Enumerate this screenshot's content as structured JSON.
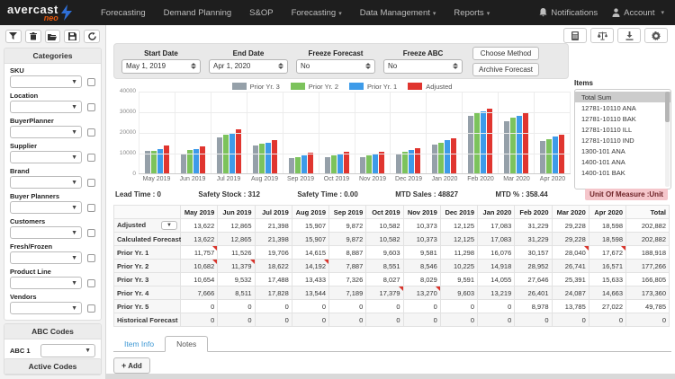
{
  "nav": {
    "brand": {
      "name": "avercast",
      "sub": "neo"
    },
    "items": [
      {
        "label": "Forecasting",
        "dropdown": false
      },
      {
        "label": "Demand Planning",
        "dropdown": false
      },
      {
        "label": "S&OP",
        "dropdown": false
      },
      {
        "label": "Forecasting",
        "dropdown": true
      },
      {
        "label": "Data Management",
        "dropdown": true
      },
      {
        "label": "Reports",
        "dropdown": true
      }
    ],
    "notifications_label": "Notifications",
    "account_label": "Account"
  },
  "sidebar": {
    "toolbar_icons": [
      "filter-icon",
      "trash-icon",
      "folder-open-icon",
      "save-icon",
      "refresh-icon"
    ],
    "categories_title": "Categories",
    "categories": [
      "SKU",
      "Location",
      "BuyerPlanner",
      "Supplier",
      "Brand",
      "Buyer Planners",
      "Customers",
      "Fresh/Frozen",
      "Product Line",
      "Vendors"
    ],
    "abc_title": "ABC Codes",
    "abc_label": "ABC 1",
    "active_codes_title": "Active Codes"
  },
  "filters": {
    "start_date": {
      "label": "Start Date",
      "value": "May 1, 2019"
    },
    "end_date": {
      "label": "End Date",
      "value": "Apr 1, 2020"
    },
    "freeze_forecast": {
      "label": "Freeze Forecast",
      "value": "No"
    },
    "freeze_abc": {
      "label": "Freeze ABC",
      "value": "No"
    },
    "choose_method_label": "Choose Method",
    "archive_forecast_label": "Archive Forecast"
  },
  "chart_data": {
    "type": "bar",
    "categories": [
      "May 2019",
      "Jun 2019",
      "Jul 2019",
      "Aug 2019",
      "Sep 2019",
      "Oct 2019",
      "Nov 2019",
      "Dec 2019",
      "Jan 2020",
      "Feb 2020",
      "Mar 2020",
      "Apr 2020"
    ],
    "series": [
      {
        "name": "Prior Yr. 3",
        "color": "#95a0a9",
        "values": [
          10654,
          9532,
          17488,
          13433,
          7326,
          8027,
          8029,
          9591,
          14055,
          27646,
          25391,
          15633
        ]
      },
      {
        "name": "Prior Yr. 2",
        "color": "#7cc35c",
        "values": [
          10682,
          11379,
          18622,
          14192,
          7887,
          8551,
          8546,
          10225,
          14918,
          28952,
          26741,
          16571
        ]
      },
      {
        "name": "Prior Yr. 1",
        "color": "#3d9be9",
        "values": [
          11757,
          11526,
          19706,
          14615,
          8887,
          9603,
          9581,
          11298,
          16076,
          30157,
          28040,
          17672
        ]
      },
      {
        "name": "Adjusted",
        "color": "#e0352f",
        "values": [
          13622,
          12865,
          21398,
          15907,
          9872,
          10582,
          10373,
          12125,
          17083,
          31229,
          29228,
          18598
        ]
      }
    ],
    "ylim": [
      0,
      40000
    ],
    "yticks": [
      0,
      10000,
      20000,
      30000,
      40000
    ],
    "legend_position": "top",
    "grid": true,
    "title": "",
    "xlabel": "",
    "ylabel": ""
  },
  "items_panel": {
    "title": "Items",
    "selected": "Total Sum",
    "list": [
      "Total Sum",
      "12781-10110 ANA",
      "12781-10110 BAK",
      "12781-10110 ILL",
      "12781-10110 IND",
      "1300-101 ANA",
      "1400-101 ANA",
      "1400-101 BAK"
    ]
  },
  "stats": [
    {
      "text": "Lead Time : 0",
      "highlight": false
    },
    {
      "text": "Safety Stock : 312",
      "highlight": false
    },
    {
      "text": "Safety Time : 0.00",
      "highlight": false
    },
    {
      "text": "MTD Sales : 48827",
      "highlight": false
    },
    {
      "text": "MTD % : 358.44",
      "highlight": false
    },
    {
      "text": "Unit Of Measure :Unit",
      "highlight": true
    }
  ],
  "table": {
    "columns": [
      "",
      "May 2019",
      "Jun 2019",
      "Jul 2019",
      "Aug 2019",
      "Sep 2019",
      "Oct 2019",
      "Nov 2019",
      "Dec 2019",
      "Jan 2020",
      "Feb 2020",
      "Mar 2020",
      "Apr 2020",
      "Total"
    ],
    "rows": [
      {
        "label": "Adjusted",
        "has_dropdown": true,
        "flags": [],
        "values": [
          "13,622",
          "12,865",
          "21,398",
          "15,907",
          "9,872",
          "10,582",
          "10,373",
          "12,125",
          "17,083",
          "31,229",
          "29,228",
          "18,598",
          "202,882"
        ]
      },
      {
        "label": "Calculated Forecast",
        "has_dropdown": false,
        "flags": [],
        "values": [
          "13,622",
          "12,865",
          "21,398",
          "15,907",
          "9,872",
          "10,582",
          "10,373",
          "12,125",
          "17,083",
          "31,229",
          "29,228",
          "18,598",
          "202,882"
        ]
      },
      {
        "label": "Prior Yr. 1",
        "has_dropdown": false,
        "flags": [
          0,
          10,
          11
        ],
        "values": [
          "11,757",
          "11,526",
          "19,706",
          "14,615",
          "8,887",
          "9,603",
          "9,581",
          "11,298",
          "16,076",
          "30,157",
          "28,040",
          "17,672",
          "188,918"
        ]
      },
      {
        "label": "Prior Yr. 2",
        "has_dropdown": false,
        "flags": [
          0,
          1,
          3
        ],
        "values": [
          "10,682",
          "11,379",
          "18,622",
          "14,192",
          "7,887",
          "8,551",
          "8,546",
          "10,225",
          "14,918",
          "28,952",
          "26,741",
          "16,571",
          "177,266"
        ]
      },
      {
        "label": "Prior Yr. 3",
        "has_dropdown": false,
        "flags": [],
        "values": [
          "10,654",
          "9,532",
          "17,488",
          "13,433",
          "7,326",
          "8,027",
          "8,029",
          "9,591",
          "14,055",
          "27,646",
          "25,391",
          "15,633",
          "166,805"
        ]
      },
      {
        "label": "Prior Yr. 4",
        "has_dropdown": false,
        "flags": [
          5,
          6
        ],
        "values": [
          "7,666",
          "8,511",
          "17,828",
          "13,544",
          "7,189",
          "17,379",
          "13,270",
          "9,603",
          "13,219",
          "26,401",
          "24,087",
          "14,663",
          "173,360"
        ]
      },
      {
        "label": "Prior Yr. 5",
        "has_dropdown": false,
        "flags": [],
        "values": [
          "0",
          "0",
          "0",
          "0",
          "0",
          "0",
          "0",
          "0",
          "0",
          "8,978",
          "13,785",
          "27,022",
          "49,785"
        ]
      },
      {
        "label": "Historical Forecast",
        "has_dropdown": false,
        "flags": [],
        "values": [
          "0",
          "0",
          "0",
          "0",
          "0",
          "0",
          "0",
          "0",
          "0",
          "0",
          "0",
          "0",
          "0"
        ]
      }
    ]
  },
  "tabs": {
    "item_info_label": "Item Info",
    "notes_label": "Notes",
    "add_label": "Add"
  },
  "colors": {
    "nav_bg": "#1e1e1e",
    "brand_accent": "#e8590c",
    "bolt_blue": "#2f6fd6",
    "uom_highlight_bg": "#f5c6cb",
    "flag_red": "#d9342b",
    "link_blue": "#3c97d3"
  }
}
